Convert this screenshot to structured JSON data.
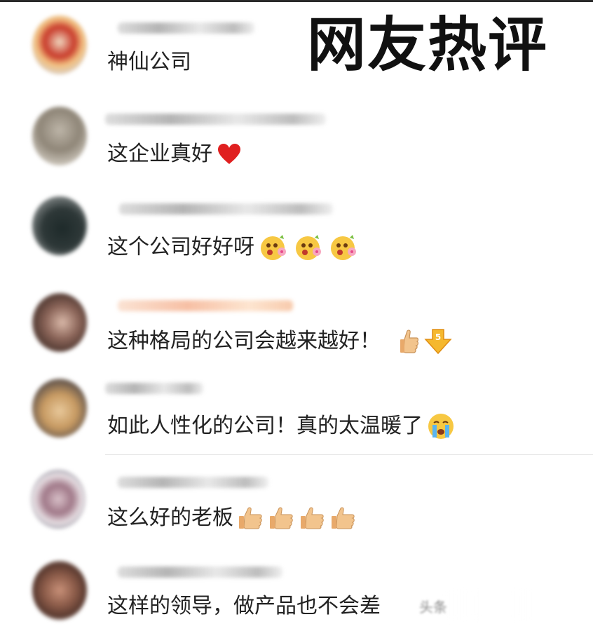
{
  "headline": "网友热评",
  "comments": [
    {
      "text": "神仙公司",
      "emojis": []
    },
    {
      "text": "这企业真好",
      "emojis": [
        "heart-icon"
      ]
    },
    {
      "text": "这个公司好好呀",
      "emojis": [
        "flower-face-icon",
        "flower-face-icon",
        "flower-face-icon"
      ]
    },
    {
      "text": "这种格局的公司会越来越好！",
      "emojis": [
        "thumbs-up-icon",
        "down-arrow-icon"
      ]
    },
    {
      "text": "如此人性化的公司！真的太温暖了",
      "emojis": [
        "crying-face-icon"
      ]
    },
    {
      "text": "这么好的老板",
      "emojis": [
        "thumbs-up-icon",
        "thumbs-up-icon",
        "thumbs-up-icon",
        "thumbs-up-icon"
      ]
    },
    {
      "text": "这样的领导，做产品也不会差",
      "emojis": []
    }
  ],
  "watermark": "头条",
  "colors": {
    "heart": "#e02020",
    "emoji_yellow": "#f7c843",
    "thumb": "#f2c48d",
    "headline": "#111111"
  }
}
